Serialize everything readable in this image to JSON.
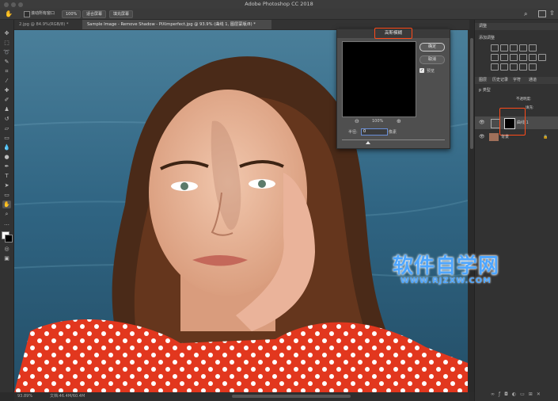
{
  "window": {
    "title": "Adobe Photoshop CC 2018"
  },
  "options_bar": {
    "checkbox_label": "滚动所有窗口",
    "zoom_button": "100%",
    "fit_screen_button": "适合屏幕",
    "fill_screen_button": "填充屏幕"
  },
  "tabs": [
    {
      "label": "2.jpg @ 84.9%(RGB/8) *"
    },
    {
      "label": "Sample Image - Remove Shadow - PiXimperfect.jpg @ 93.9% (曲线 1, 图层蒙版/8) *"
    }
  ],
  "status": {
    "zoom": "93.89%",
    "doc": "文档:46.4M/60.4M"
  },
  "dialog": {
    "title": "高斯模糊",
    "ok_label": "确定",
    "cancel_label": "取消",
    "preview_label": "预览",
    "preview_zoom": "100%",
    "radius_label": "半径:",
    "radius_value": "0",
    "radius_unit": "像素"
  },
  "panels": {
    "adjustments_tab": "调整",
    "add_adjustment_label": "添加调整",
    "layers_tabs": [
      "图层",
      "历史记录",
      "字符",
      "通道"
    ],
    "kind_label": "p 类型",
    "opacity_label": "不透明度:",
    "fill_label": "填充:",
    "layers": [
      {
        "name": "曲线 1"
      },
      {
        "name": "背景"
      }
    ]
  },
  "watermark": {
    "main": "软件自学网",
    "url": "WWW.RJZXW.COM"
  },
  "colors": {
    "highlight": "#ff4b1a",
    "watermark": "#4ea6ff",
    "panel_bg": "#323232"
  }
}
